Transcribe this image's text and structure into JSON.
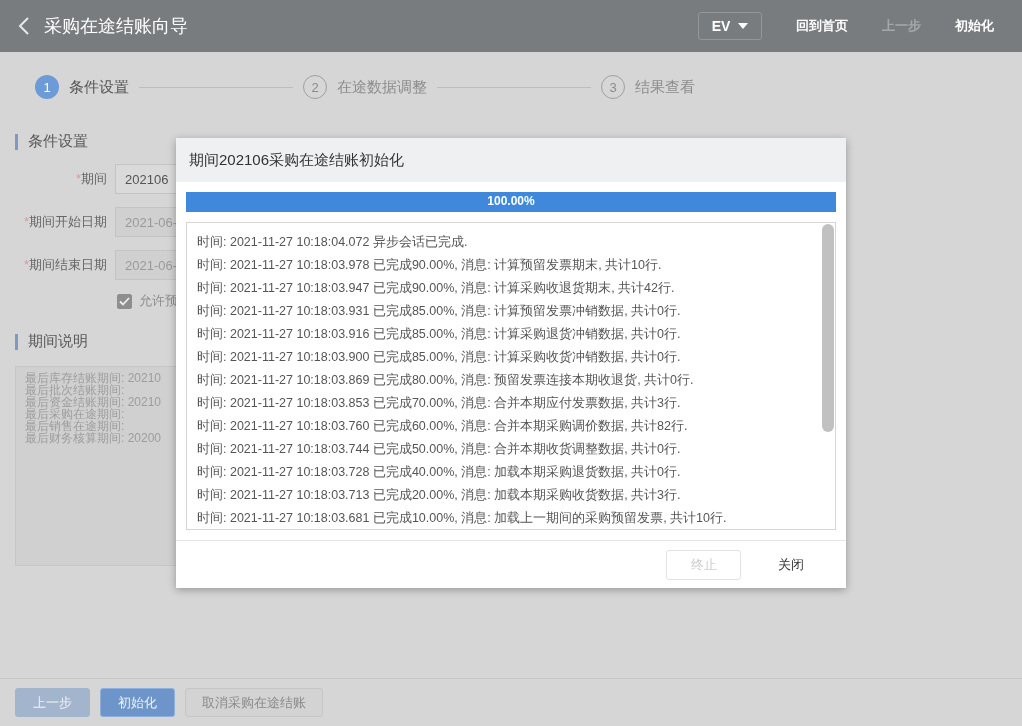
{
  "header": {
    "title": "采购在途结账向导",
    "lang_select": "EV",
    "buttons": [
      {
        "label": "回到首页",
        "disabled": false
      },
      {
        "label": "上一步",
        "disabled": true
      },
      {
        "label": "初始化",
        "disabled": false
      }
    ]
  },
  "steps": [
    {
      "number": "1",
      "label": "条件设置",
      "selected": true
    },
    {
      "number": "2",
      "label": "在途数据调整",
      "selected": false
    },
    {
      "number": "3",
      "label": "结果查看",
      "selected": false
    }
  ],
  "conditions": {
    "title": "条件设置",
    "required_mark": "*",
    "fields": [
      {
        "label": "期间",
        "required": true,
        "value": "202106",
        "disabled": false
      },
      {
        "label": "期间开始日期",
        "required": true,
        "value": "2021-06-",
        "disabled": true
      },
      {
        "label": "期间结束日期",
        "required": true,
        "value": "2021-06-",
        "disabled": true
      }
    ],
    "checkbox": {
      "label": "允许预",
      "checked": true
    }
  },
  "period_note": {
    "title": "期间说明",
    "lines": [
      "最后库存结账期间: 20210",
      "最后批次结账期间:",
      "最后资金结账期间: 20210",
      "最后采购在途期间:",
      "最后销售在途期间:",
      "最后财务核算期间: 20200"
    ]
  },
  "footer_buttons": [
    {
      "label": "上一步",
      "kind": "primary",
      "disabled": true
    },
    {
      "label": "初始化",
      "kind": "primary",
      "disabled": false
    },
    {
      "label": "取消采购在途结账",
      "kind": "default",
      "disabled": false
    }
  ],
  "dialog": {
    "title": "期间202106采购在途结账初始化",
    "progress": {
      "level": 1,
      "reading": "100.00%"
    },
    "log": [
      "时间: 2021-11-27 10:18:04.072 异步会话已完成.",
      "时间: 2021-11-27 10:18:03.978 已完成90.00%, 消息: 计算预留发票期末, 共计10行.",
      "时间: 2021-11-27 10:18:03.947 已完成90.00%, 消息: 计算采购收退货期末, 共计42行.",
      "时间: 2021-11-27 10:18:03.931 已完成85.00%, 消息: 计算预留发票冲销数据, 共计0行.",
      "时间: 2021-11-27 10:18:03.916 已完成85.00%, 消息: 计算采购退货冲销数据, 共计0行.",
      "时间: 2021-11-27 10:18:03.900 已完成85.00%, 消息: 计算采购收货冲销数据, 共计0行.",
      "时间: 2021-11-27 10:18:03.869 已完成80.00%, 消息: 预留发票连接本期收退货, 共计0行.",
      "时间: 2021-11-27 10:18:03.853 已完成70.00%, 消息: 合并本期应付发票数据, 共计3行.",
      "时间: 2021-11-27 10:18:03.760 已完成60.00%, 消息: 合并本期采购调价数据, 共计82行.",
      "时间: 2021-11-27 10:18:03.744 已完成50.00%, 消息: 合并本期收货调整数据, 共计0行.",
      "时间: 2021-11-27 10:18:03.728 已完成40.00%, 消息: 加载本期采购退货数据, 共计0行.",
      "时间: 2021-11-27 10:18:03.713 已完成20.00%, 消息: 加载本期采购收货数据, 共计3行.",
      "时间: 2021-11-27 10:18:03.681 已完成10.00%, 消息: 加载上一期间的采购预留发票, 共计10行."
    ],
    "buttons": [
      {
        "label": "终止",
        "disabled": true
      },
      {
        "label": "关闭",
        "disabled": false
      }
    ]
  }
}
